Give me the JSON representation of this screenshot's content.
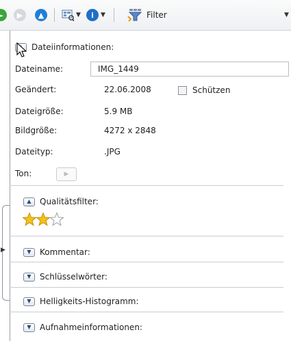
{
  "toolbar": {
    "filter_label": "Filter",
    "icons": [
      "green-back-icon",
      "grey-circle-icon",
      "up-arrow-icon",
      "view-options-icon",
      "info-icon",
      "filter-icon"
    ]
  },
  "file_info": {
    "header": "Dateiinformationen:",
    "filename_label": "Dateiname:",
    "filename_value": "IMG_1449",
    "modified_label": "Geändert:",
    "modified_value": "22.06.2008",
    "protect_label": "Schützen",
    "protect_checked": false,
    "filesize_label": "Dateigröße:",
    "filesize_value": "5.9 MB",
    "imagesize_label": "Bildgröße:",
    "imagesize_value": "4272 x 2848",
    "filetype_label": "Dateityp:",
    "filetype_value": ".JPG",
    "sound_label": "Ton:"
  },
  "sections": {
    "quality": "Qualitätsfilter:",
    "quality_rating": 2,
    "quality_max": 3,
    "comment": "Kommentar:",
    "keywords": "Schlüsselwörter:",
    "histogram": "Helligkeits-Histogramm:",
    "shooting": "Aufnahmeinformationen:"
  },
  "colors": {
    "green_button": "#3aa53a",
    "up_button": "#1f7fd4",
    "info_button": "#1f6fc8",
    "star_filled": "#f2c21b",
    "star_empty": "#ffffff"
  }
}
